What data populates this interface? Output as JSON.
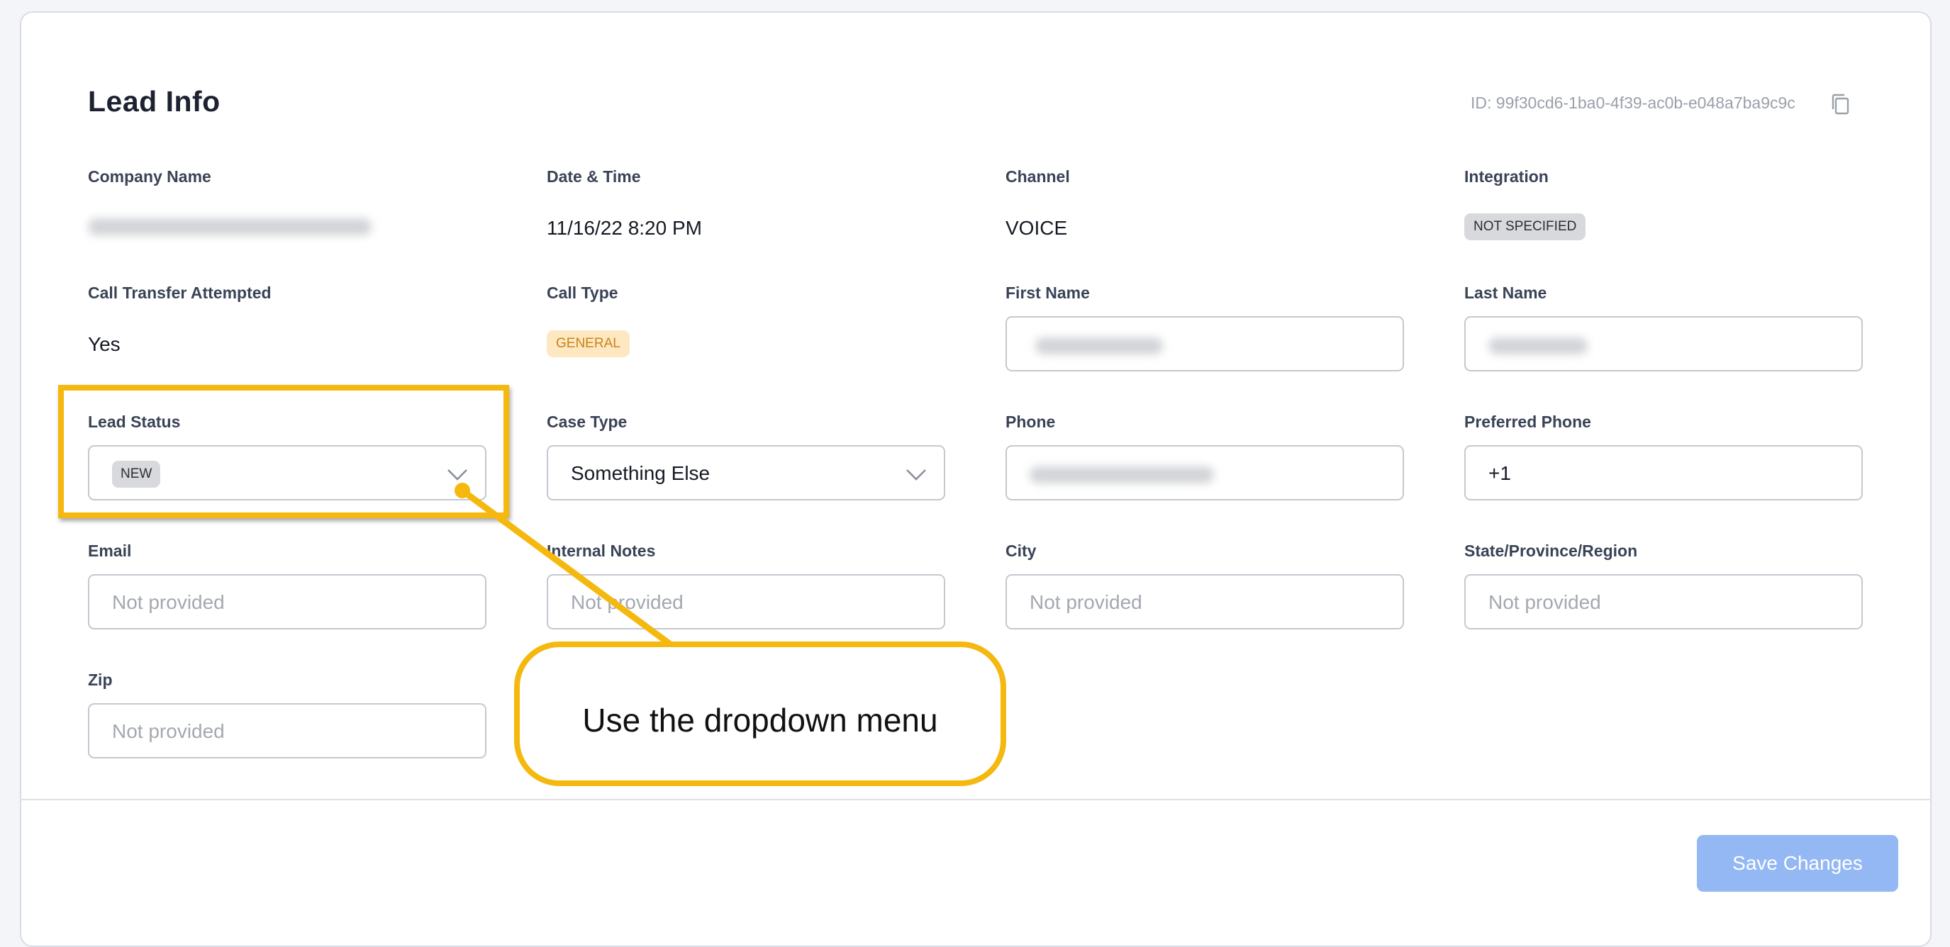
{
  "header": {
    "title": "Lead Info",
    "lead_id": "ID: 99f30cd6-1ba0-4f39-ac0b-e048a7ba9c9c",
    "copy_icon": "copy-icon"
  },
  "fields": {
    "company_name": {
      "label": "Company Name",
      "value": ""
    },
    "date_time": {
      "label": "Date & Time",
      "value": "11/16/22 8:20 PM"
    },
    "channel": {
      "label": "Channel",
      "value": "VOICE"
    },
    "integration": {
      "label": "Integration",
      "value": "NOT SPECIFIED"
    },
    "call_transfer_attempted": {
      "label": "Call Transfer Attempted",
      "value": "Yes"
    },
    "call_type": {
      "label": "Call Type",
      "value": "GENERAL"
    },
    "first_name": {
      "label": "First Name",
      "value": ""
    },
    "last_name": {
      "label": "Last Name",
      "value": ""
    },
    "lead_status": {
      "label": "Lead Status",
      "value": "NEW"
    },
    "case_type": {
      "label": "Case Type",
      "value": "Something Else"
    },
    "phone": {
      "label": "Phone",
      "value": ""
    },
    "preferred_phone": {
      "label": "Preferred Phone",
      "value": "+1"
    },
    "email": {
      "label": "Email",
      "placeholder": "Not provided"
    },
    "internal_notes": {
      "label": "Internal Notes",
      "placeholder": "Not provided"
    },
    "city": {
      "label": "City",
      "placeholder": "Not provided"
    },
    "state": {
      "label": "State/Province/Region",
      "placeholder": "Not provided"
    },
    "zip": {
      "label": "Zip",
      "placeholder": "Not provided"
    }
  },
  "footer": {
    "save_label": "Save Changes"
  },
  "annotation": {
    "callout_text": "Use the dropdown menu"
  },
  "colors": {
    "accent_yellow": "#f5b80f",
    "save_button": "#93b8f3",
    "general_badge_bg": "#fde8c2",
    "general_badge_text": "#c98315",
    "neutral_badge_bg": "#d8d9dc"
  }
}
